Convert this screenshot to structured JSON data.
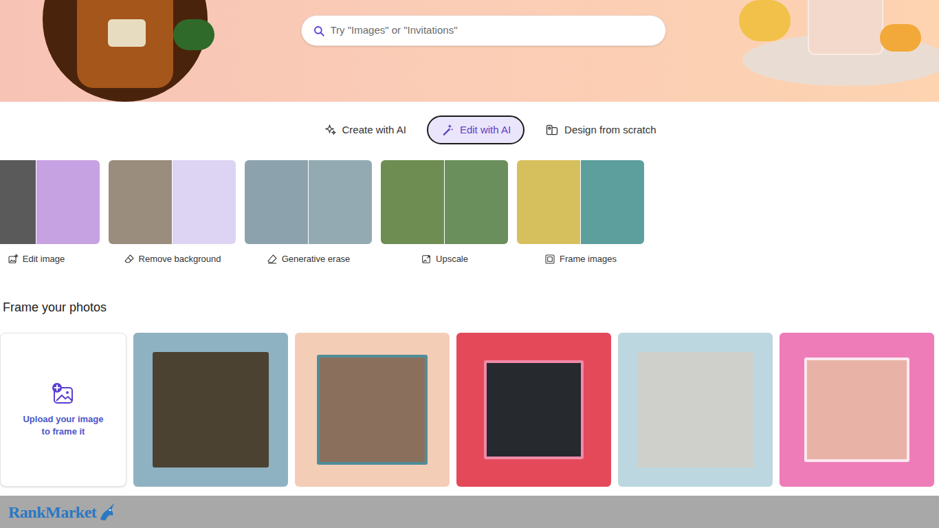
{
  "search": {
    "placeholder": "Try \"Images\" or \"Invitations\""
  },
  "tabs": [
    {
      "label": "Create with AI",
      "selected": false
    },
    {
      "label": "Edit with AI",
      "selected": true
    },
    {
      "label": "Design from scratch",
      "selected": false
    }
  ],
  "tools": [
    {
      "label": "Edit image"
    },
    {
      "label": "Remove background"
    },
    {
      "label": "Generative erase"
    },
    {
      "label": "Upscale"
    },
    {
      "label": "Frame images"
    }
  ],
  "section": {
    "title": "Frame your photos"
  },
  "upload": {
    "label": "Upload your image to frame it"
  },
  "watermark": {
    "text": "RankMarket"
  }
}
